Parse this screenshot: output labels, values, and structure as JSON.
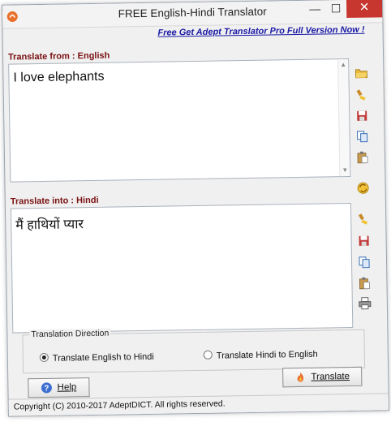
{
  "window": {
    "title": "FREE English-Hindi Translator",
    "minimize": "—",
    "maximize": "☐",
    "close": "✕"
  },
  "promo_link": "Free Get Adept Translator Pro Full Version Now !",
  "source": {
    "label": "Translate from : English",
    "text": "I love elephants"
  },
  "target": {
    "label": "Translate into : Hindi",
    "text": "मैं हाथियों प्यार"
  },
  "direction": {
    "label": "Translation Direction",
    "options": [
      "Translate English to Hindi",
      "Translate Hindi to English"
    ],
    "selected": "Translate English to Hindi"
  },
  "buttons": {
    "help": "Help",
    "translate": "Translate"
  },
  "status": "Copyright (C) 2010-2017 AdeptDICT. All rights reserved.",
  "icons": {
    "source_toolbar": [
      "open-folder-icon",
      "clear-brush-icon",
      "save-icon",
      "copy-icon",
      "paste-icon"
    ],
    "middle": "swap-icon",
    "target_toolbar": [
      "clear-brush-icon",
      "save-icon",
      "copy-icon",
      "paste-icon",
      "print-icon"
    ]
  },
  "colors": {
    "label_red": "#7a1010",
    "link_blue": "#1a1aa6",
    "close_red": "#c7372f"
  }
}
